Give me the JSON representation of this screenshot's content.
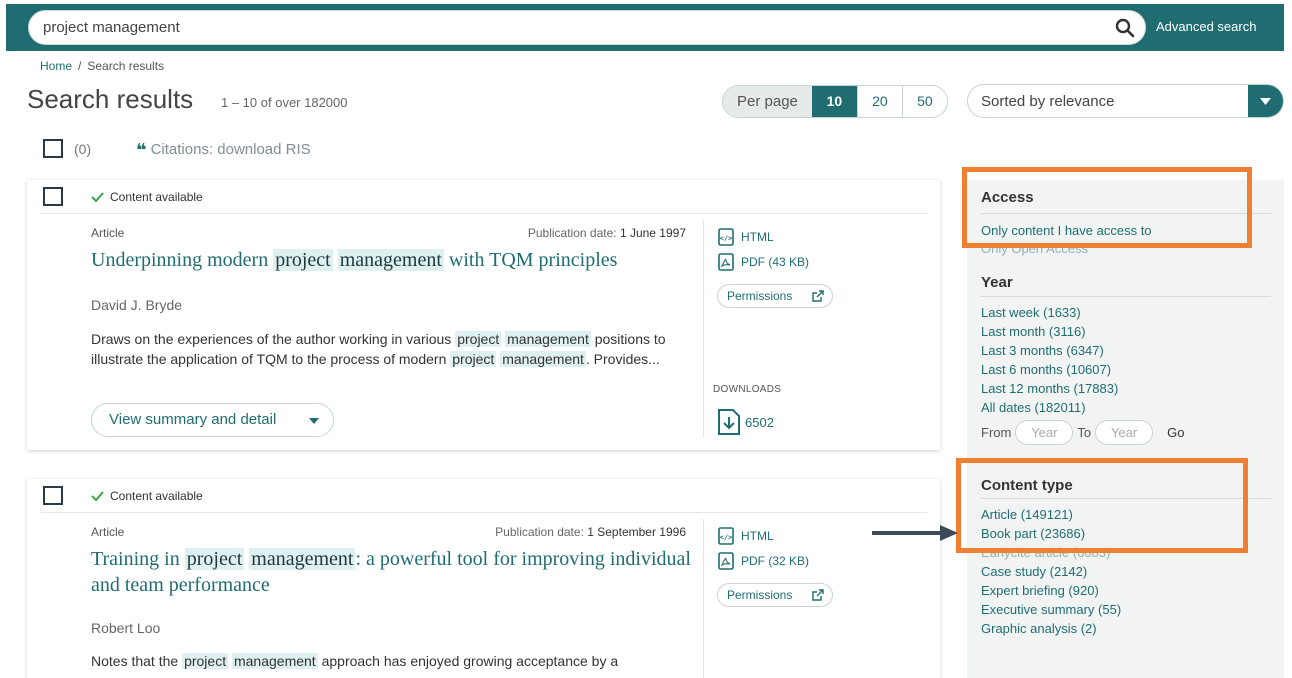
{
  "search": {
    "value": "project management",
    "advanced_label": "Advanced search"
  },
  "breadcrumb": {
    "home": "Home",
    "separator": "/",
    "current": "Search results"
  },
  "header": {
    "title": "Search results",
    "count": "1 – 10 of over 182000"
  },
  "per_page": {
    "label": "Per page",
    "options": [
      "10",
      "20",
      "50"
    ],
    "selected": "10"
  },
  "sort": {
    "value": "Sorted by relevance"
  },
  "selection": {
    "count": "(0)",
    "citations": "Citations: download RIS"
  },
  "results": [
    {
      "availability": "Content available",
      "type": "Article",
      "pub_label": "Publication date:",
      "pub_date": "1 June 1997",
      "title_parts": [
        "Underpinning modern ",
        "project",
        " ",
        "management",
        " with TQM principles"
      ],
      "author": "David J. Bryde",
      "abstract_parts": [
        "Draws on the experiences of the author working in various ",
        "project",
        " ",
        "management",
        " positions to illustrate the application of TQM to the process of modern ",
        "project",
        " ",
        "management",
        ". Provides..."
      ],
      "summary_label": "View summary and detail",
      "html_label": "HTML",
      "pdf_label": "PDF (43 KB)",
      "permissions_label": "Permissions",
      "downloads_label": "DOWNLOADS",
      "downloads": "6502"
    },
    {
      "availability": "Content available",
      "type": "Article",
      "pub_label": "Publication date:",
      "pub_date": "1 September 1996",
      "title_parts": [
        "Training in ",
        "project",
        " ",
        "management",
        ": a powerful tool for improving individual and team performance"
      ],
      "author": "Robert Loo",
      "abstract_parts": [
        "Notes that the ",
        "project",
        " ",
        "management",
        " approach has enjoyed growing acceptance by a"
      ],
      "html_label": "HTML",
      "pdf_label": "PDF (32 KB)",
      "permissions_label": "Permissions"
    }
  ],
  "facets": {
    "access": {
      "title": "Access",
      "items": [
        "Only content I have access to",
        "Only Open Access"
      ]
    },
    "year": {
      "title": "Year",
      "items": [
        "Last week (1633)",
        "Last month (3116)",
        "Last 3 months (6347)",
        "Last 6 months (10607)",
        "Last 12 months (17883)",
        "All dates (182011)"
      ],
      "from_label": "From",
      "to_label": "To",
      "placeholder": "Year",
      "go_label": "Go"
    },
    "content_type": {
      "title": "Content type",
      "items": [
        "Article (149121)",
        "Book part (23686)",
        "Earlycite article (6083)",
        "Case study (2142)",
        "Expert briefing (920)",
        "Executive summary (55)",
        "Graphic analysis (2)"
      ]
    }
  },
  "colors": {
    "teal": "#1f6d71",
    "highlight": "#dff0f1",
    "annotation": "#f07f32",
    "arrow": "#3c4a5c"
  }
}
